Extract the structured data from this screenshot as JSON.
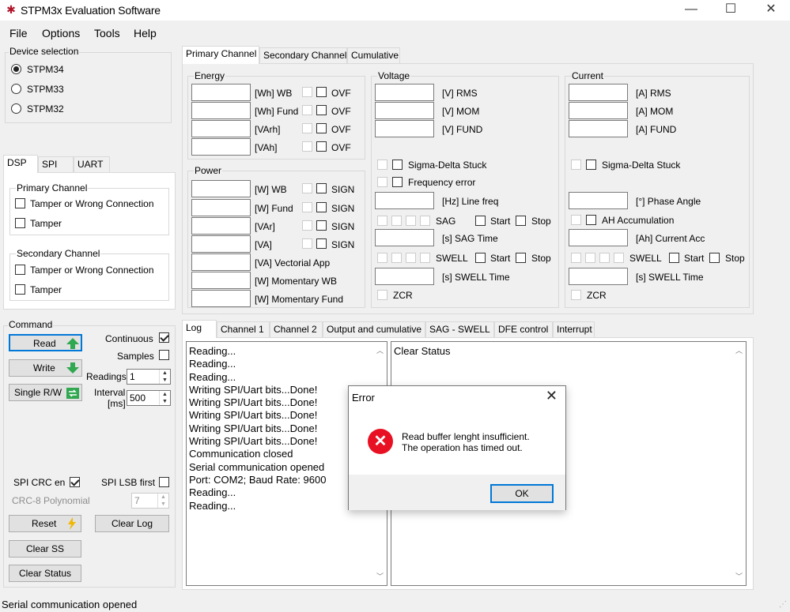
{
  "window": {
    "title": "STPM3x Evaluation Software",
    "minimize": "—",
    "maximize": "☐",
    "close": "✕"
  },
  "menu": [
    "File",
    "Options",
    "Tools",
    "Help"
  ],
  "device": {
    "label": "Device selection",
    "options": [
      "STPM34",
      "STPM33",
      "STPM32"
    ],
    "selected": 0
  },
  "left_tabs": [
    "DSP",
    "SPI",
    "UART"
  ],
  "dsp": {
    "primary": {
      "label": "Primary Channel",
      "items": [
        "Tamper or Wrong Connection",
        "Tamper"
      ]
    },
    "secondary": {
      "label": "Secondary Channel",
      "items": [
        "Tamper or Wrong Connection",
        "Tamper"
      ]
    }
  },
  "command": {
    "label": "Command",
    "read": "Read",
    "write": "Write",
    "single": "Single R/W",
    "continuous": "Continuous",
    "samples": "Samples",
    "readings_label": "Readings",
    "readings_value": "1",
    "interval_label": "Interval",
    "interval_unit": "[ms]",
    "interval_value": "500",
    "spi_crc": "SPI CRC en",
    "spi_lsb": "SPI LSB first",
    "crc_poly": "CRC-8 Polynomial",
    "crc_value": "7",
    "reset": "Reset",
    "clear_log": "Clear Log",
    "clear_ss": "Clear SS",
    "clear_status": "Clear Status"
  },
  "main_tabs": [
    "Primary Channel",
    "Secondary Channel",
    "Cumulative"
  ],
  "energy": {
    "label": "Energy",
    "rows": [
      "[Wh] WB",
      "[Wh] Fund",
      "[VArh]",
      "[VAh]"
    ],
    "flag": "OVF"
  },
  "power": {
    "label": "Power",
    "rows": [
      "[W] WB",
      "[W] Fund",
      "[VAr]",
      "[VA]"
    ],
    "flag": "SIGN",
    "extra": [
      "[VA] Vectorial App",
      "[W] Momentary WB",
      "[W] Momentary Fund"
    ]
  },
  "voltage": {
    "label": "Voltage",
    "rows": [
      "[V] RMS",
      "[V] MOM",
      "[V] FUND"
    ],
    "sigma": "Sigma-Delta Stuck",
    "freq_err": "Frequency error",
    "line_freq": "[Hz] Line freq",
    "sag": "SAG",
    "start": "Start",
    "stop": "Stop",
    "sag_time": "[s] SAG Time",
    "swell": "SWELL",
    "swell_time": "[s] SWELL Time",
    "zcr": "ZCR"
  },
  "current": {
    "label": "Current",
    "rows": [
      "[A] RMS",
      "[A] MOM",
      "[A] FUND"
    ],
    "sigma": "Sigma-Delta Stuck",
    "phase": "[°] Phase Angle",
    "ah_acc": "AH Accumulation",
    "cur_acc": "[Ah] Current Acc",
    "swell": "SWELL",
    "start": "Start",
    "stop": "Stop",
    "swell_time": "[s] SWELL Time",
    "zcr": "ZCR"
  },
  "log_tabs": [
    "Log",
    "Channel 1",
    "Channel 2",
    "Output and cumulative",
    "SAG - SWELL",
    "DFE control",
    "Interrupt"
  ],
  "log_lines": [
    "Reading...",
    "Reading...",
    "Reading...",
    "Writing SPI/Uart bits...Done!",
    "Writing SPI/Uart bits...Done!",
    "Writing SPI/Uart bits...Done!",
    "Writing SPI/Uart bits...Done!",
    "Writing SPI/Uart bits...Done!",
    "Communication closed",
    "Serial communication opened",
    "Port: COM2; Baud Rate: 9600",
    "Reading...",
    "Reading..."
  ],
  "status_panel": "Clear Status",
  "dialog": {
    "title": "Error",
    "line1": "Read buffer lenght insufficient.",
    "line2": "The operation has timed out.",
    "ok": "OK"
  },
  "statusbar": "Serial communication opened"
}
